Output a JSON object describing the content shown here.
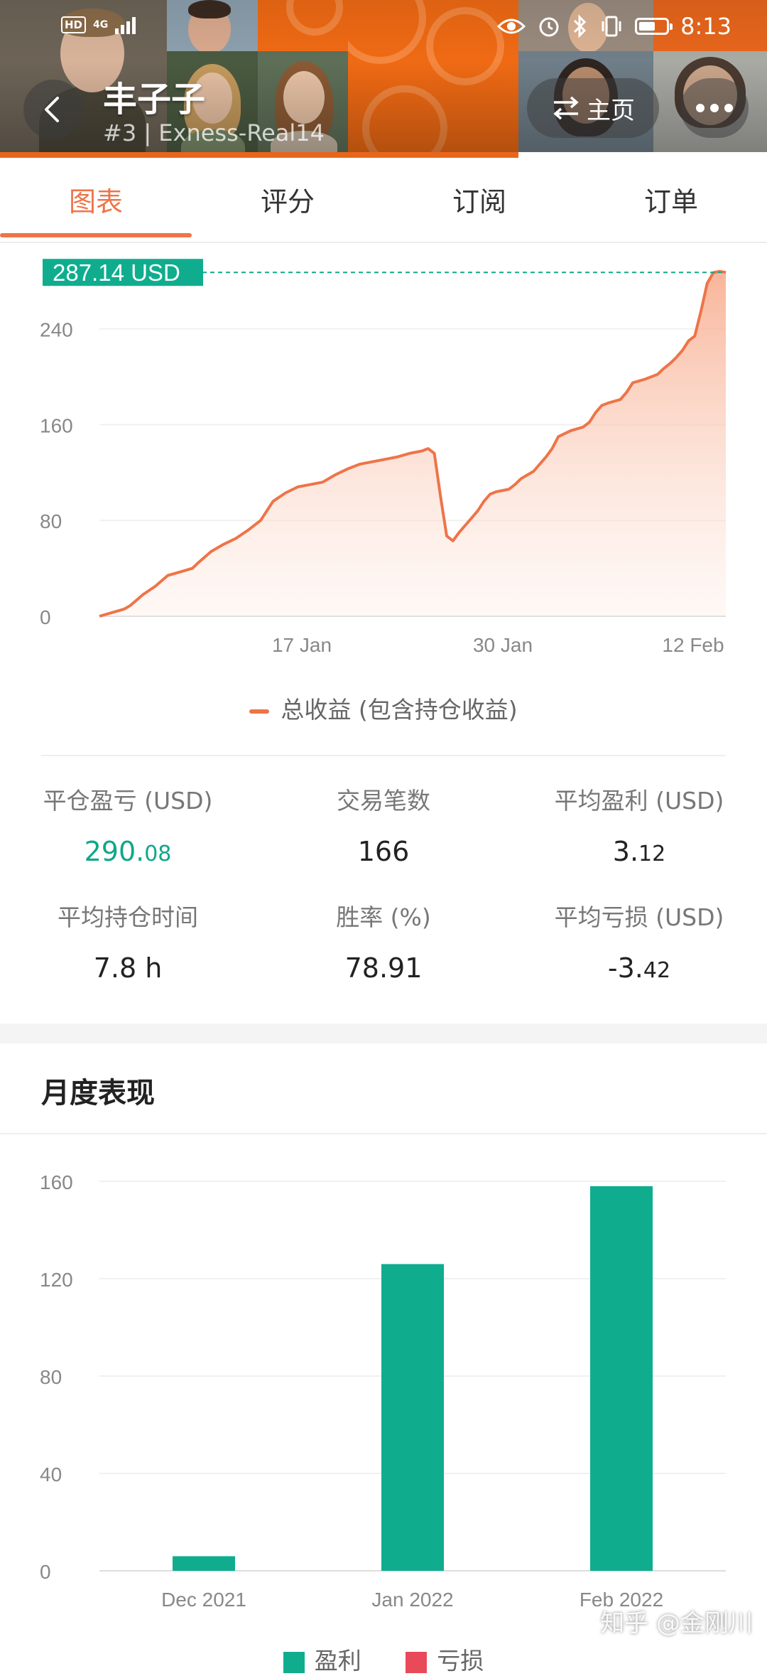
{
  "status_bar": {
    "hd": "HD",
    "network": "4G",
    "time": "8:13"
  },
  "header": {
    "trader_name": "丰子子",
    "trader_sub": "#3 | Exness-Real14",
    "home_label": "主页"
  },
  "tabs": [
    {
      "label": "图表",
      "active": true
    },
    {
      "label": "评分",
      "active": false
    },
    {
      "label": "订阅",
      "active": false
    },
    {
      "label": "订单",
      "active": false
    }
  ],
  "equity_chart": {
    "current_label": "287.14 USD",
    "legend": "总收益 (包含持仓收益)"
  },
  "stats": {
    "closed_pnl_label": "平仓盈亏 (USD)",
    "closed_pnl_int": "290.",
    "closed_pnl_dec": "08",
    "trades_label": "交易笔数",
    "trades_value": "166",
    "avg_profit_label": "平均盈利 (USD)",
    "avg_profit_int": "3.",
    "avg_profit_dec": "12",
    "avg_hold_label": "平均持仓时间",
    "avg_hold_value": "7.8 h",
    "win_rate_label": "胜率 (%)",
    "win_rate_value": "78.91",
    "avg_loss_label": "平均亏损 (USD)",
    "avg_loss_int": "-3.",
    "avg_loss_dec": "42"
  },
  "monthly": {
    "title": "月度表现",
    "legend_profit": "盈利",
    "legend_loss": "亏损"
  },
  "colors": {
    "accent": "#ee7448",
    "profit": "#0fad8e",
    "loss": "#e94a5a",
    "header_orange": "#e8661c"
  },
  "watermark": "知乎 @金刚川",
  "chart_data": [
    {
      "type": "area",
      "title": "",
      "series": [
        {
          "name": "总收益 (包含持仓收益)"
        }
      ],
      "x_ticks": [
        "17 Jan",
        "30 Jan",
        "12 Feb"
      ],
      "y_ticks": [
        0,
        80,
        160,
        240
      ],
      "ylim": [
        0,
        295
      ],
      "current_value": 287.14,
      "points": [
        [
          0,
          0
        ],
        [
          2,
          3
        ],
        [
          4,
          6
        ],
        [
          5,
          9
        ],
        [
          7,
          18
        ],
        [
          9,
          25
        ],
        [
          11,
          34
        ],
        [
          13,
          37
        ],
        [
          15,
          40
        ],
        [
          16,
          45
        ],
        [
          18,
          54
        ],
        [
          20,
          60
        ],
        [
          22,
          65
        ],
        [
          24,
          72
        ],
        [
          26,
          80
        ],
        [
          28,
          96
        ],
        [
          30,
          103
        ],
        [
          32,
          108
        ],
        [
          34,
          110
        ],
        [
          36,
          112
        ],
        [
          38,
          118
        ],
        [
          40,
          123
        ],
        [
          42,
          127
        ],
        [
          44,
          129
        ],
        [
          46,
          131
        ],
        [
          48,
          133
        ],
        [
          50,
          136
        ],
        [
          52,
          138
        ],
        [
          53,
          140
        ],
        [
          54,
          136
        ],
        [
          55,
          100
        ],
        [
          56,
          67
        ],
        [
          57,
          63
        ],
        [
          58,
          70
        ],
        [
          59,
          76
        ],
        [
          60,
          82
        ],
        [
          61,
          88
        ],
        [
          62,
          96
        ],
        [
          63,
          102
        ],
        [
          64,
          104
        ],
        [
          66,
          106
        ],
        [
          67,
          110
        ],
        [
          68,
          115
        ],
        [
          70,
          121
        ],
        [
          71,
          127
        ],
        [
          72,
          133
        ],
        [
          73,
          140
        ],
        [
          74,
          150
        ],
        [
          76,
          155
        ],
        [
          78,
          158
        ],
        [
          79,
          162
        ],
        [
          80,
          170
        ],
        [
          81,
          176
        ],
        [
          82,
          178
        ],
        [
          84,
          181
        ],
        [
          85,
          187
        ],
        [
          86,
          195
        ],
        [
          88,
          198
        ],
        [
          90,
          202
        ],
        [
          91,
          207
        ],
        [
          92,
          211
        ],
        [
          93,
          216
        ],
        [
          94,
          222
        ],
        [
          95,
          230
        ],
        [
          96,
          234
        ],
        [
          97,
          255
        ],
        [
          98,
          278
        ],
        [
          99,
          287
        ],
        [
          100,
          288
        ],
        [
          101,
          287.14
        ]
      ]
    },
    {
      "type": "bar",
      "title": "月度表现",
      "categories": [
        "Dec 2021",
        "Jan 2022",
        "Feb 2022"
      ],
      "series": [
        {
          "name": "盈利",
          "values": [
            6,
            126,
            158
          ]
        },
        {
          "name": "亏损",
          "values": [
            0,
            0,
            0
          ]
        }
      ],
      "y_ticks": [
        0,
        40,
        80,
        120,
        160
      ],
      "ylim": [
        0,
        165
      ],
      "legend": "bottom"
    }
  ]
}
